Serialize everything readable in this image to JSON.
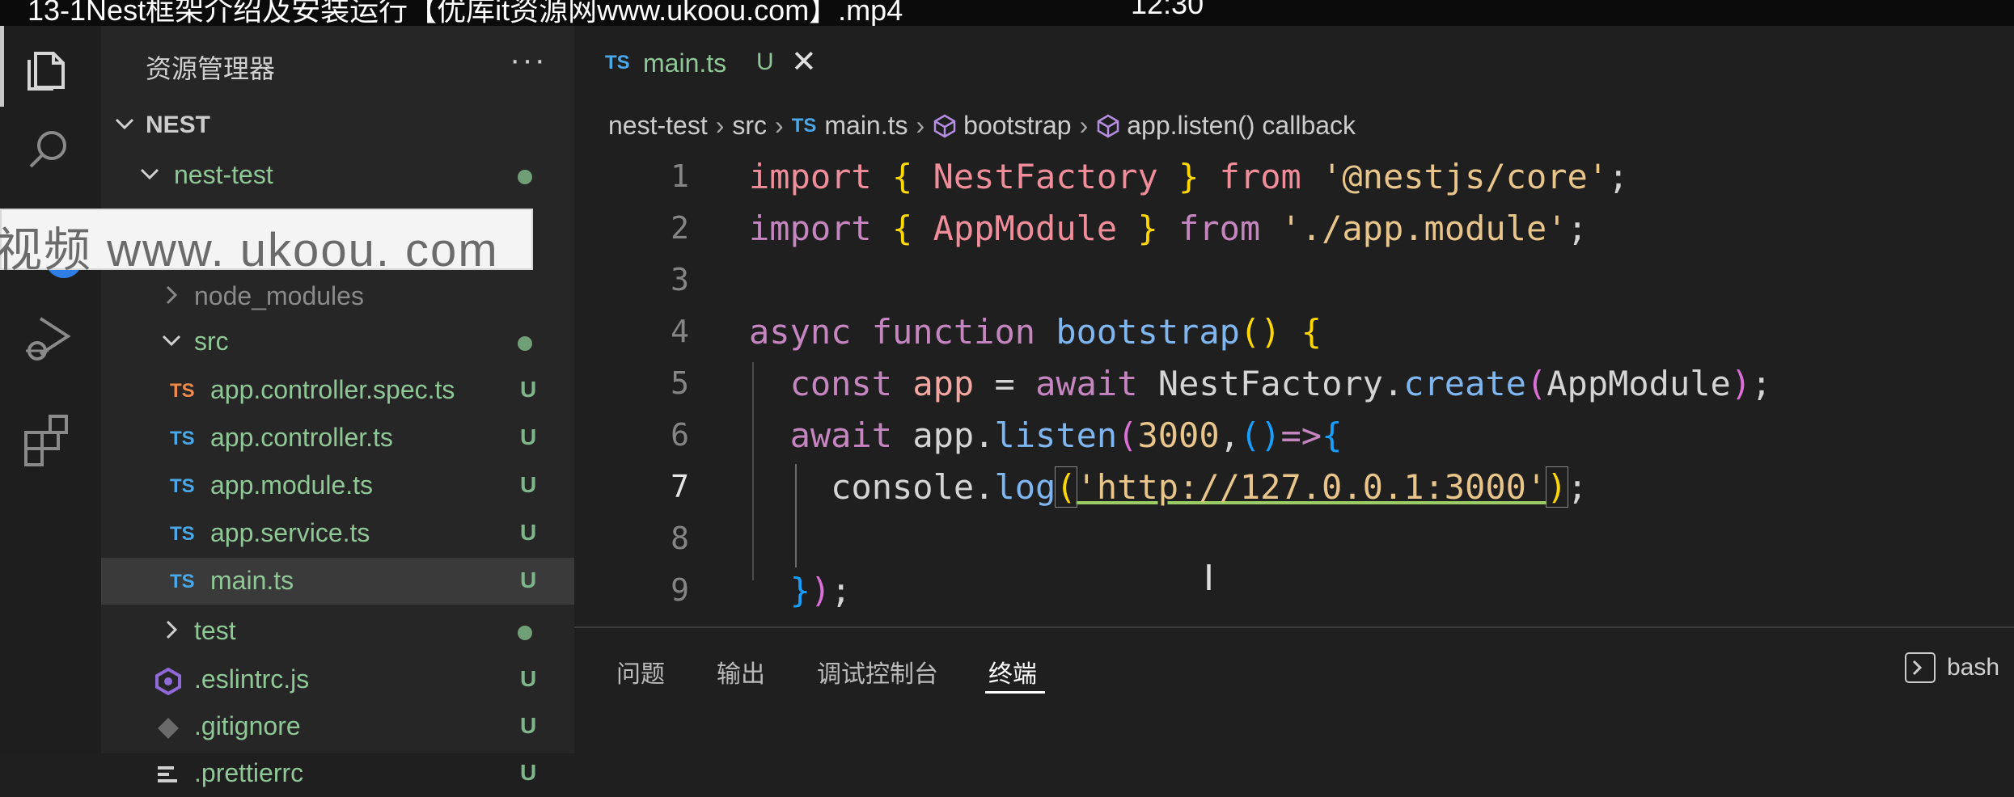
{
  "video": {
    "title": "13-1Nest框架介绍及安装运行【优库it资源网www.ukoou.com】.mp4",
    "time": "12:30"
  },
  "activity_bar": {
    "items": [
      {
        "icon": "files-icon"
      },
      {
        "icon": "search-icon"
      },
      {
        "icon": "source-control-icon",
        "badge": "16"
      },
      {
        "icon": "run-debug-icon"
      },
      {
        "icon": "extensions-icon"
      }
    ]
  },
  "sidebar": {
    "title": "资源管理器",
    "more": "···",
    "root": "NEST",
    "tree": [
      {
        "label": "nest-test"
      },
      {
        "label": "node_modules"
      },
      {
        "label": "src"
      },
      {
        "label": "app.controller.spec.ts",
        "status": "U"
      },
      {
        "label": "app.controller.ts",
        "status": "U"
      },
      {
        "label": "app.module.ts",
        "status": "U"
      },
      {
        "label": "app.service.ts",
        "status": "U"
      },
      {
        "label": "main.ts",
        "status": "U"
      },
      {
        "label": "test"
      },
      {
        "label": ".eslintrc.js",
        "status": "U"
      },
      {
        "label": ".gitignore",
        "status": "U"
      },
      {
        "label": ".prettierrc",
        "status": "U"
      }
    ],
    "ts_badge": "TS"
  },
  "watermark": "视频 www. ukoou. com",
  "editor": {
    "tab": {
      "ts": "TS",
      "name": "main.ts",
      "status": "U",
      "close": "✕"
    },
    "breadcrumb": [
      "nest-test",
      "src",
      "main.ts",
      "bootstrap",
      "app.listen() callback"
    ],
    "line_numbers": [
      "1",
      "2",
      "3",
      "4",
      "5",
      "6",
      "7",
      "8",
      "9"
    ],
    "active_line": "7",
    "code": [
      "import { NestFactory } from '@nestjs/core';",
      "import { AppModule } from './app.module';",
      "",
      "async function bootstrap() {",
      "  const app = await NestFactory.create(AppModule);",
      "  await app.listen(3000,()=>{",
      "    console.log('http://127.0.0.1:3000');",
      "",
      "  });"
    ]
  },
  "panel": {
    "tabs": [
      "问题",
      "输出",
      "调试控制台",
      "终端"
    ],
    "active_tab": "终端",
    "shell": "bash"
  },
  "colors": {
    "accent_blue": "#2f7ee6",
    "untracked_green": "#8fc797",
    "ts_blue": "#4aa8e8"
  }
}
